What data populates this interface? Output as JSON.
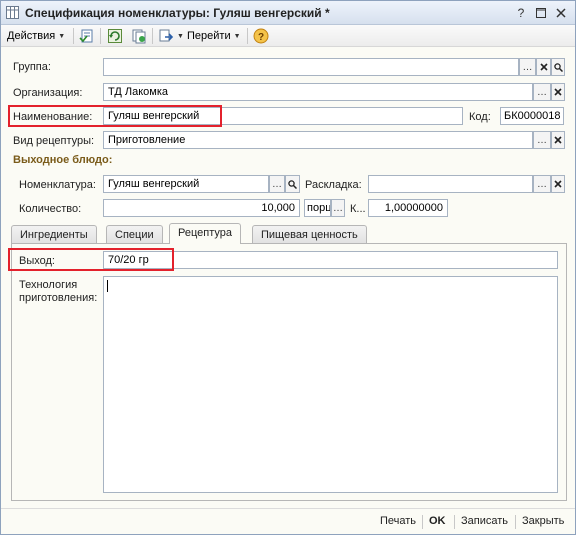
{
  "window": {
    "title": "Спецификация номенклатуры: Гуляш венгерский *",
    "icon": "table-icon"
  },
  "toolbar": {
    "actions_label": "Действия",
    "goto_label": "Перейти"
  },
  "form": {
    "group_label": "Группа:",
    "group_value": "",
    "organization_label": "Организация:",
    "organization_value": "ТД Лакомка",
    "name_label": "Наименование:",
    "name_value": "Гуляш венгерский",
    "code_label": "Код:",
    "code_value": "БК0000018",
    "recipe_type_label": "Вид рецептуры:",
    "recipe_type_value": "Приготовление"
  },
  "output_dish": {
    "section_title": "Выходное блюдо:",
    "nomenclature_label": "Номенклатура:",
    "nomenclature_value": "Гуляш венгерский",
    "layout_label": "Раскладка:",
    "layout_value": "",
    "quantity_label": "Количество:",
    "quantity_value": "10,000",
    "unit_value": "порц",
    "k_label": "К...",
    "k_value": "1,00000000"
  },
  "tabs": [
    {
      "label": "Ингредиенты"
    },
    {
      "label": "Специи"
    },
    {
      "label": "Рецептура"
    },
    {
      "label": "Пищевая ценность"
    }
  ],
  "recipe_tab": {
    "output_label": "Выход:",
    "output_value": "70/20 гр",
    "technology_label_1": "Технология",
    "technology_label_2": "приготовления:",
    "technology_value": ""
  },
  "footer": {
    "print_label": "Печать",
    "ok_label": "OK",
    "save_label": "Записать",
    "close_label": "Закрыть"
  },
  "colors": {
    "highlight": "#e3212c",
    "section_title": "#7a5b1a",
    "help_icon": "#e8a21c"
  }
}
